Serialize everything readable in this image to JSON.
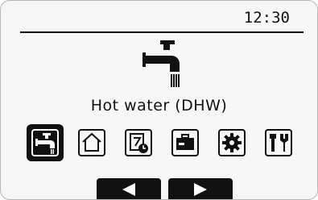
{
  "status_bar": {
    "time": "12:30"
  },
  "main": {
    "hero_icon": "hot-water-tap-icon",
    "title": "Hot water (DHW)"
  },
  "menu": {
    "selected_index": 0,
    "items": [
      {
        "icon": "hot-water-tap-icon"
      },
      {
        "icon": "house-icon"
      },
      {
        "icon": "schedule-timer-icon"
      },
      {
        "icon": "holiday-suitcase-icon"
      },
      {
        "icon": "settings-gear-icon"
      },
      {
        "icon": "service-tools-icon"
      }
    ]
  },
  "nav": {
    "left_icon": "arrow-left-icon",
    "right_icon": "arrow-right-icon"
  },
  "colors": {
    "foreground": "#111111",
    "background": "#f7f7f7",
    "selected_background": "#111111"
  }
}
